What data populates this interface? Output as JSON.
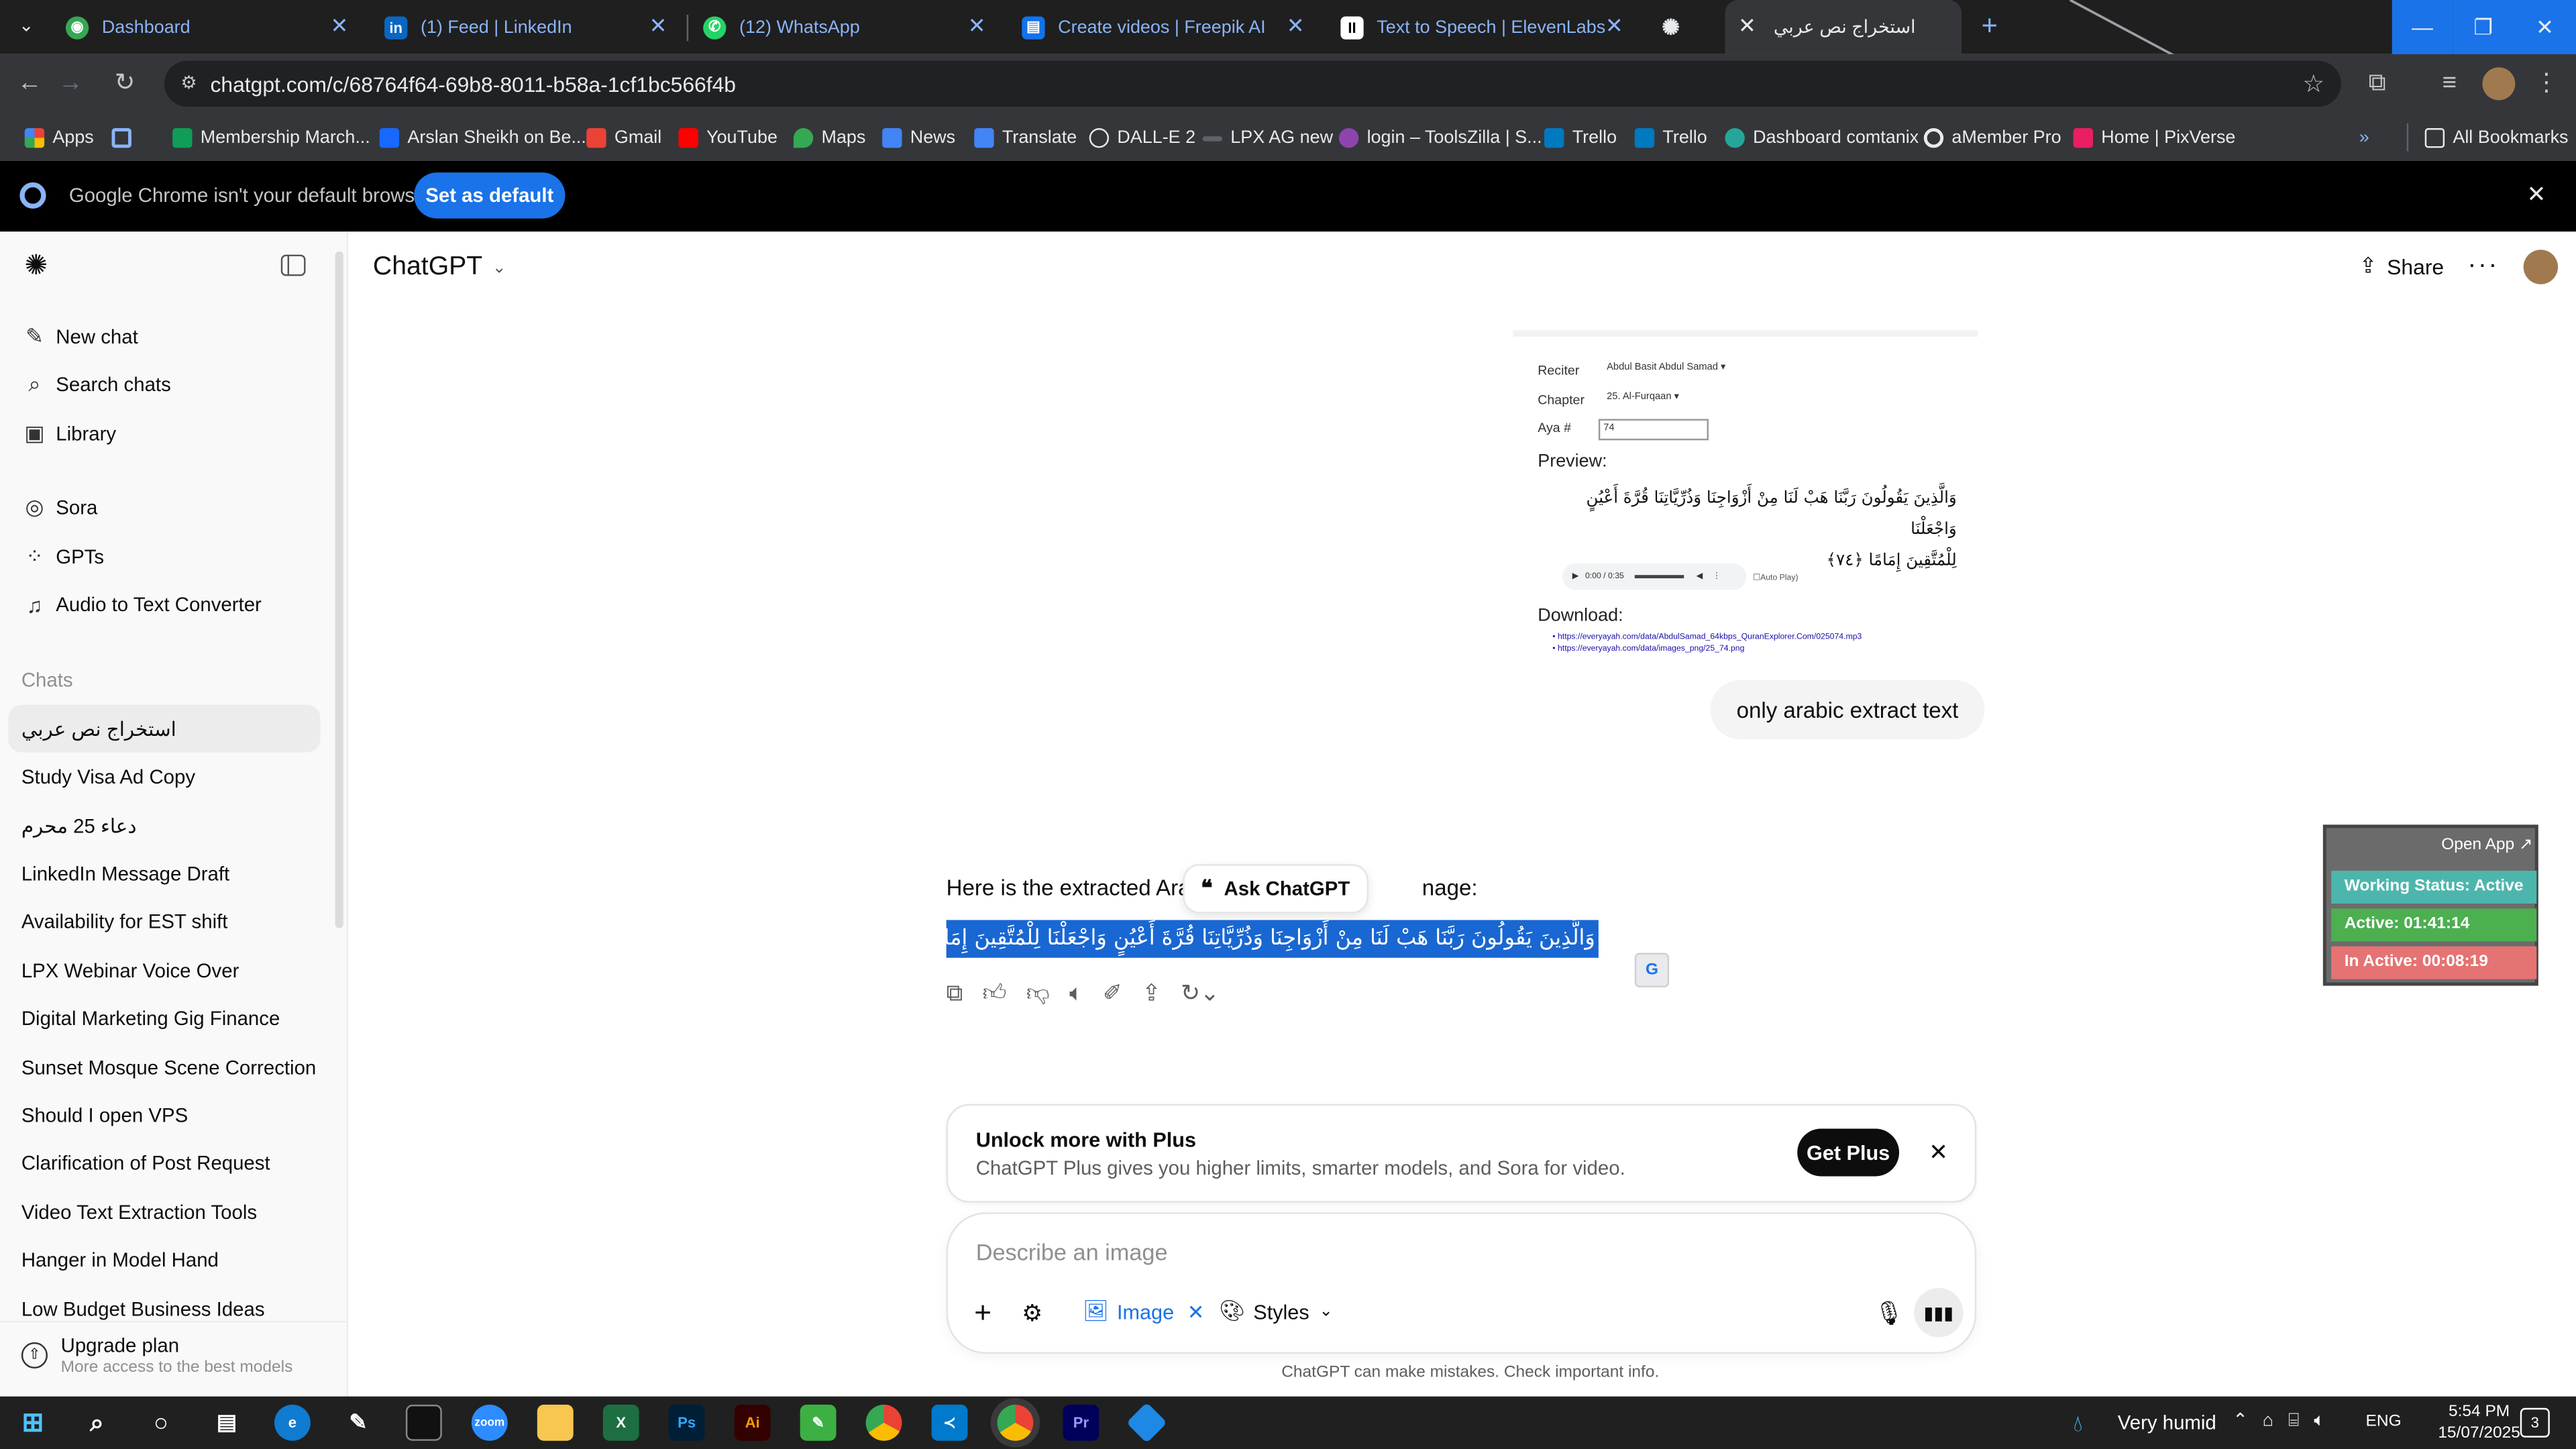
{
  "browser": {
    "tabs": [
      {
        "title": "Dashboard",
        "icon": "globe-icon"
      },
      {
        "title": "(1) Feed | LinkedIn",
        "icon": "linkedin-icon"
      },
      {
        "title": "(12) WhatsApp",
        "icon": "whatsapp-icon"
      },
      {
        "title": "Create videos | Freepik AI",
        "icon": "freepik-icon"
      },
      {
        "title": "Text to Speech | ElevenLabs",
        "icon": "elevenlabs-icon"
      },
      {
        "title": "",
        "icon": "chatgpt-icon"
      },
      {
        "title": "استخراج نص عربي",
        "icon": "chatgpt-icon"
      }
    ],
    "url": "chatgpt.com/c/68764f64-69b8-8011-b58a-1cf1bc566f4b",
    "bookmarks": [
      "Apps",
      "Membership March...",
      "Arslan Sheikh on Be...",
      "Gmail",
      "YouTube",
      "Maps",
      "News",
      "Translate",
      "DALL-E 2",
      "LPX AG new",
      "login – ToolsZilla | S...",
      "Trello",
      "Trello",
      "Dashboard comtanix",
      "aMember Pro",
      "Home | PixVerse"
    ],
    "all_bookmarks": "All Bookmarks",
    "banner": {
      "text": "Google Chrome isn't your default browser",
      "button": "Set as default"
    }
  },
  "sidebar": {
    "top_items": [
      "New chat",
      "Search chats",
      "Library"
    ],
    "apps": [
      "Sora",
      "GPTs",
      "Audio to Text Converter"
    ],
    "chats_label": "Chats",
    "chats": [
      "استخراج نص عربي",
      "Study Visa Ad Copy",
      "دعاء 25 محرم",
      "LinkedIn Message Draft",
      "Availability for EST shift",
      "LPX Webinar Voice Over",
      "Digital Marketing Gig Finance",
      "Sunset Mosque Scene Correction",
      "Should I open VPS",
      "Clarification of Post Request",
      "Video Text Extraction Tools",
      "Hanger in Model Hand",
      "Low Budget Business Ideas"
    ],
    "upgrade": {
      "title": "Upgrade plan",
      "subtitle": "More access to the best models"
    }
  },
  "header": {
    "model": "ChatGPT",
    "share": "Share"
  },
  "uploaded_image": {
    "reciter_label": "Reciter",
    "reciter_value": "Abdul Basit Abdul Samad",
    "chapter_label": "Chapter",
    "chapter_value": "25. Al-Furqaan",
    "aya_label": "Aya #",
    "aya_value": "74",
    "preview_label": "Preview:",
    "verse_line1": "وَالَّذِينَ يَقُولُونَ رَبَّنَا هَبْ لَنَا مِنْ أَزْوَاجِنَا وَذُرِّيَّاتِنَا قُرَّةَ أَعْيُنٍ وَاجْعَلْنَا",
    "verse_line2": "لِلْمُتَّقِينَ إِمَامًا ﴿٧٤﴾",
    "audio_time": "0:00 / 0:35",
    "autoplay": "Auto Play)",
    "download_label": "Download:",
    "link1": "https://everyayah.com/data/AbdulSamad_64kbps_QuranExplorer.Com/025074.mp3",
    "link2": "https://everyayah.com/data/images_png/25_74.png"
  },
  "user_message": "only arabic extract text",
  "assistant": {
    "intro_start": "Here is the extracted Aral",
    "intro_end": "nage:",
    "arabic": "وَالَّذِينَ يَقُولُونَ رَبَّنَا هَبْ لَنَا مِنْ أَزْوَاجِنَا وَذُرِّيَّاتِنَا قُرَّةَ أَعْيُنٍ وَاجْعَلْنَا لِلْمُتَّقِينَ إِمَامًا",
    "ask_chatgpt": "Ask ChatGPT"
  },
  "widget": {
    "open_app": "Open App ↗",
    "working": "Working Status: Active",
    "active": "Active: 01:41:14",
    "inactive": "In Active: 00:08:19",
    "colors": {
      "working": "#4db6ac",
      "active": "#4caf50",
      "inactive": "#e57373"
    }
  },
  "plus_banner": {
    "title": "Unlock more with Plus",
    "subtitle": "ChatGPT Plus gives you higher limits, smarter models, and Sora for video.",
    "button": "Get Plus"
  },
  "composer": {
    "placeholder": "Describe an image",
    "image_chip": "Image",
    "styles": "Styles"
  },
  "disclaimer": "ChatGPT can make mistakes. Check important info.",
  "taskbar": {
    "weather": "Very humid",
    "lang": "ENG",
    "time": "5:54 PM",
    "date": "15/07/2025",
    "notifications": "3"
  }
}
